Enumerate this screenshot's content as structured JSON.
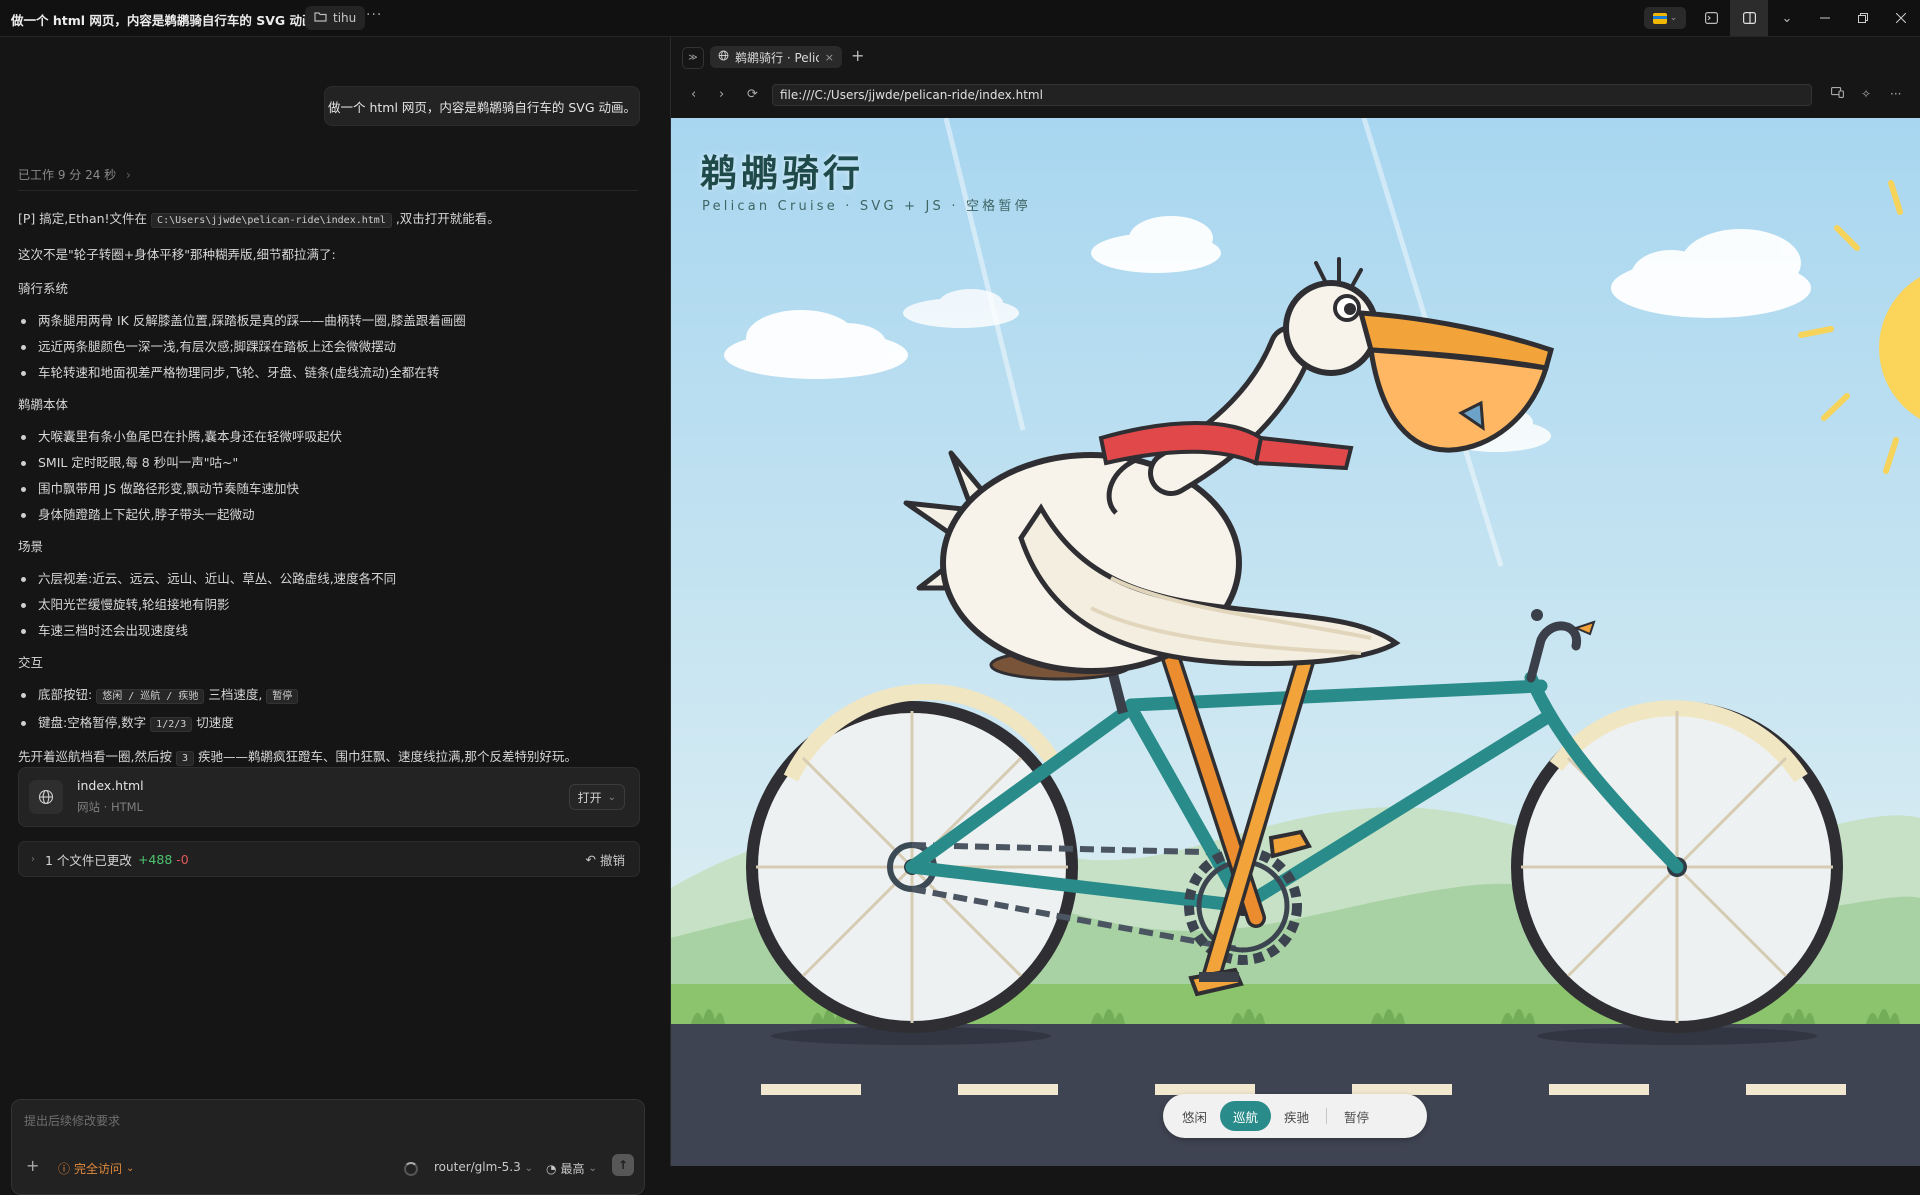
{
  "window": {
    "title": "做一个 html 网页，内容是鹈鹕骑自行车的 SVG 动画。",
    "project": "tihu"
  },
  "chat": {
    "user_message": "做一个 html 网页，内容是鹈鹕骑自行车的 SVG 动画。",
    "worked_time": "已工作 9 分 24 秒",
    "intro_pre": "[P] 搞定,Ethan!文件在",
    "intro_path": "C:\\Users\\jjwde\\pelican-ride\\index.html",
    "intro_post": ",双击打开就能看。",
    "lead": "这次不是\"轮子转圈+身体平移\"那种糊弄版,细节都拉满了:",
    "sections": [
      {
        "heading": "骑行系统",
        "items": [
          "两条腿用两骨 IK 反解膝盖位置,踩踏板是真的踩——曲柄转一圈,膝盖跟着画圈",
          "远近两条腿颜色一深一浅,有层次感;脚踝踩在踏板上还会微微摆动",
          "车轮转速和地面视差严格物理同步,飞轮、牙盘、链条(虚线流动)全都在转"
        ]
      },
      {
        "heading": "鹈鹕本体",
        "items": [
          "大喉囊里有条小鱼尾巴在扑腾,囊本身还在轻微呼吸起伏",
          "SMIL 定时眨眼,每 8 秒叫一声\"咕~\"",
          "围巾飘带用 JS 做路径形变,飘动节奏随车速加快",
          "身体随蹬踏上下起伏,脖子带头一起微动"
        ]
      },
      {
        "heading": "场景",
        "items": [
          "六层视差:近云、远云、远山、近山、草丛、公路虚线,速度各不同",
          "太阳光芒缓慢旋转,轮组接地有阴影",
          "车速三档时还会出现速度线"
        ]
      }
    ],
    "interaction": {
      "heading": "交互",
      "buttons_pre": "底部按钮:",
      "buttons_code": "悠闲 / 巡航 / 疾驰",
      "buttons_mid": "三档速度,",
      "pause_code": "暂停",
      "keyboard_pre": "键盘:空格暂停,数字",
      "keyboard_code": "1/2/3",
      "keyboard_post": "切速度"
    },
    "closing_pre": "先开着巡航档看一圈,然后按",
    "closing_code": "3",
    "closing_post": "疾驰——鹈鹕疯狂蹬车、围巾狂飘、速度线拉满,那个反差特别好玩。",
    "file_card": {
      "name": "index.html",
      "subtitle": "网站 · HTML",
      "open_label": "打开"
    },
    "changes": {
      "label": "1 个文件已更改",
      "added": "+488",
      "removed": "-0",
      "undo_label": "撤销"
    },
    "composer": {
      "placeholder": "提出后续修改要求",
      "access": "完全访问",
      "model": "router/glm-5.3",
      "effort": "最高"
    }
  },
  "browser": {
    "tab_title": "鹈鹕骑行 · Pelican Cruise",
    "url": "file:///C:/Users/jjwde/pelican-ride/index.html",
    "page": {
      "title": "鹈鹕骑行",
      "subtitle": "Pelican Cruise · SVG + JS · 空格暂停",
      "controls": [
        "悠闲",
        "巡航",
        "疾驰",
        "暂停"
      ],
      "active_control": "巡航"
    }
  },
  "colors": {
    "accent_orange": "#e28a3c",
    "added_green": "#4ec270",
    "removed_red": "#e05a5a",
    "control_active": "#2a8c8a",
    "bike_frame": "#2a8c8a",
    "pelican_beak": "#f2a33a",
    "scarf": "#e0484a"
  }
}
